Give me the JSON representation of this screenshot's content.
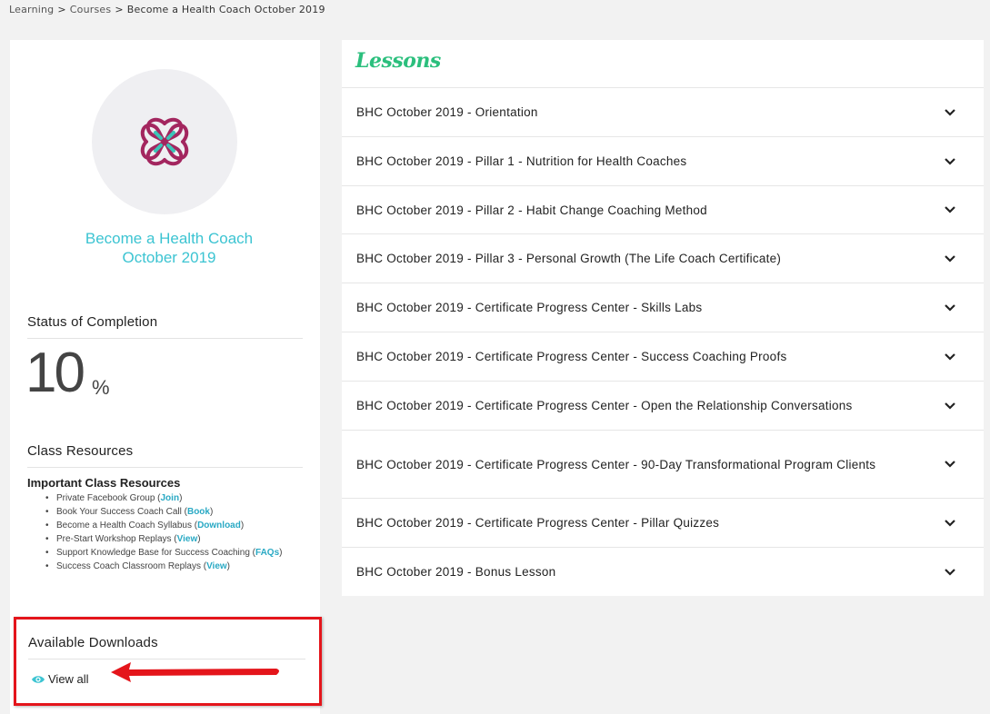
{
  "breadcrumb": {
    "items": [
      "Learning",
      "Courses"
    ],
    "separator": ">",
    "current": "Become a Health Coach October 2019"
  },
  "course": {
    "title_line1": "Become a Health Coach",
    "title_line2": "October 2019",
    "logo_icon": "celtic-knot-logo-icon",
    "accent_color": "#3cc4d2",
    "logo_colors": [
      "#a3265f",
      "#3cc4b8"
    ]
  },
  "status": {
    "heading": "Status of Completion",
    "value": "10",
    "unit": "%",
    "progress_percent": 10
  },
  "resources": {
    "heading": "Class Resources",
    "title": "Important Class Resources",
    "items": [
      {
        "text": "Private Facebook Group (",
        "link": "Join",
        "suffix": ")"
      },
      {
        "text": "Book Your Success Coach Call (",
        "link": "Book",
        "suffix": ")"
      },
      {
        "text": "Become a Health Coach Syllabus (",
        "link": "Download",
        "suffix": ")"
      },
      {
        "text": "Pre-Start Workshop Replays (",
        "link": "View",
        "suffix": ")"
      },
      {
        "text": "Support Knowledge Base for Success Coaching (",
        "link": "FAQs",
        "suffix": ")"
      },
      {
        "text": "Success Coach Classroom Replays (",
        "link": "View",
        "suffix": ")"
      }
    ]
  },
  "downloads": {
    "heading": "Available Downloads",
    "view_all_label": "View all",
    "view_icon": "eye-icon",
    "highlight_color": "#e4151b"
  },
  "lessons": {
    "title": "Lessons",
    "title_color": "#2bbf7d",
    "items": [
      "BHC October 2019 - Orientation",
      "BHC October 2019 - Pillar 1 - Nutrition for Health Coaches",
      "BHC October 2019 - Pillar 2 - Habit Change Coaching Method",
      "BHC October 2019 - Pillar 3 - Personal Growth (The Life Coach Certificate)",
      "BHC October 2019 - Certificate Progress Center - Skills Labs",
      "BHC October 2019 - Certificate Progress Center - Success Coaching Proofs",
      "BHC October 2019 - Certificate Progress Center - Open the Relationship Conversations",
      "BHC October 2019 - Certificate Progress Center - 90-Day Transformational Program Clients",
      "BHC October 2019 - Certificate Progress Center - Pillar Quizzes",
      "BHC October 2019 - Bonus Lesson"
    ],
    "expand_icon": "chevron-down-icon"
  }
}
